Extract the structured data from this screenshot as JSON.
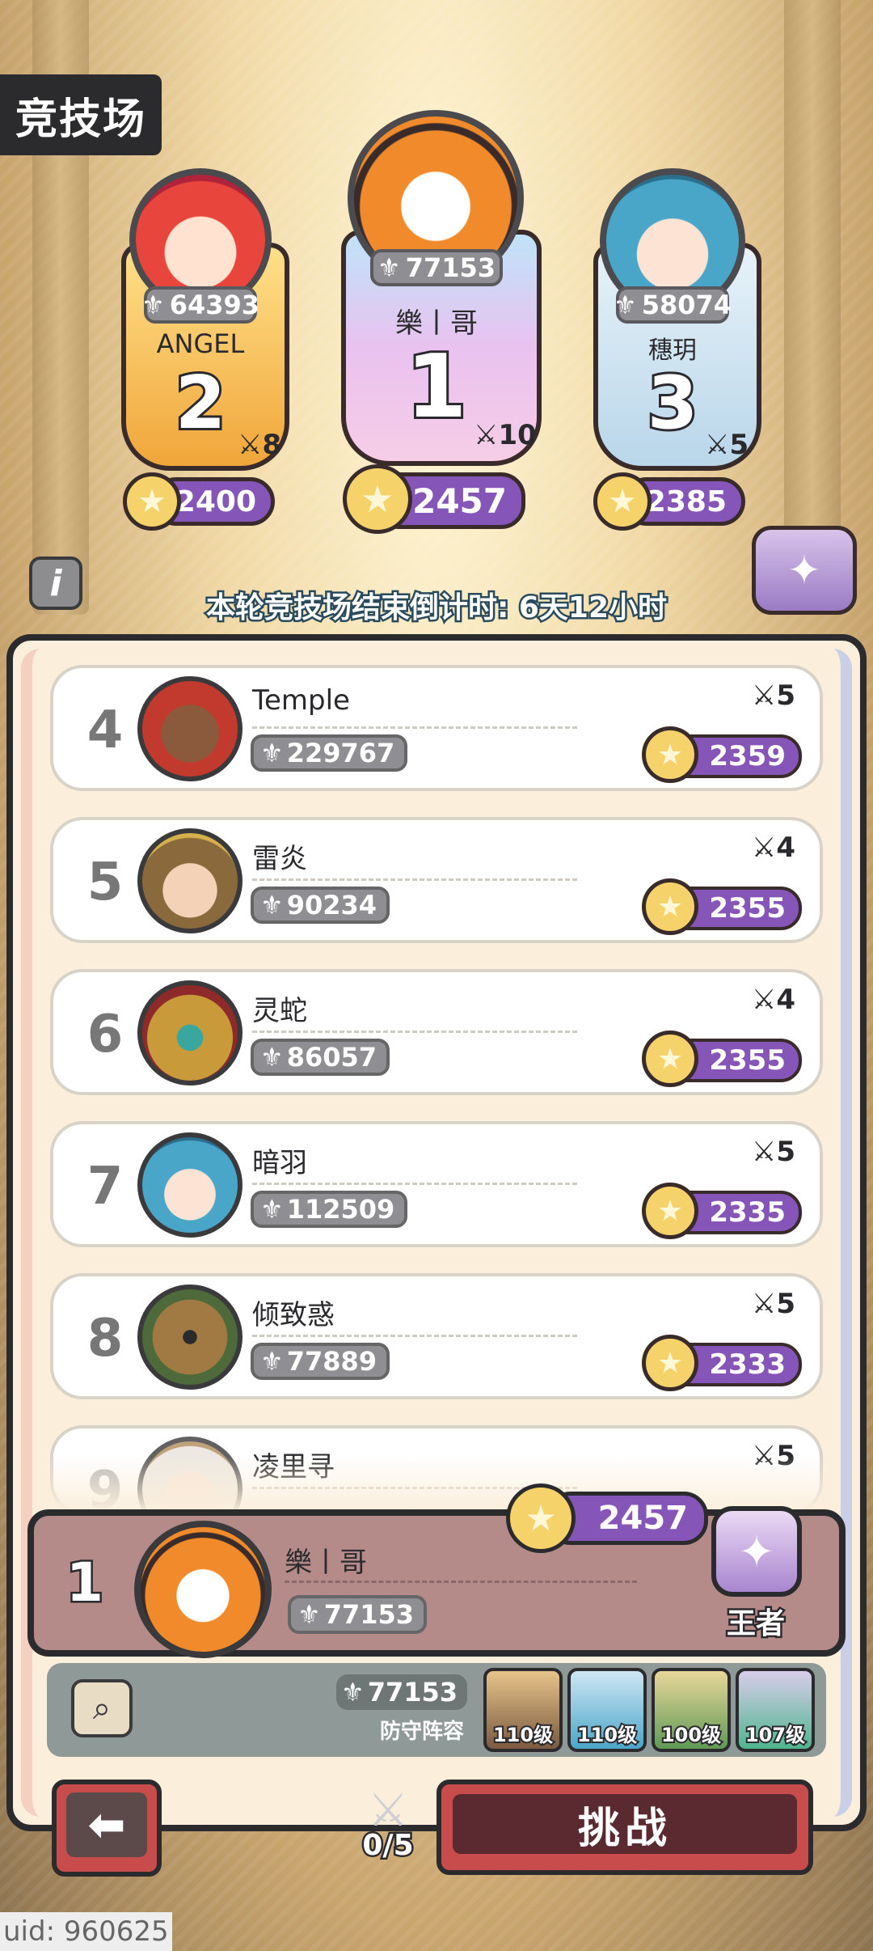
{
  "screen": {
    "title": "竞技场"
  },
  "top3": [
    {
      "rank": "2",
      "name": "ANGEL",
      "power": "64393",
      "score": "2400",
      "wins": "8",
      "color": "#f5b83a"
    },
    {
      "rank": "1",
      "name": "樂丨哥",
      "power": "77153",
      "score": "2457",
      "wins": "10",
      "color": "#c7b2ea"
    },
    {
      "rank": "3",
      "name": "穗玥",
      "power": "58074",
      "score": "2385",
      "wins": "5",
      "color": "#cfe6f4"
    }
  ],
  "countdown": "本轮竞技场结束倒计时: 6天12小时",
  "rows": [
    {
      "rank": "4",
      "name": "Temple",
      "power": "229767",
      "score": "2359",
      "wins": "5"
    },
    {
      "rank": "5",
      "name": "雷炎",
      "power": "90234",
      "score": "2355",
      "wins": "4"
    },
    {
      "rank": "6",
      "name": "灵蛇",
      "power": "86057",
      "score": "2355",
      "wins": "4"
    },
    {
      "rank": "7",
      "name": "暗羽",
      "power": "112509",
      "score": "2335",
      "wins": "5"
    },
    {
      "rank": "8",
      "name": "倾致惑",
      "power": "77889",
      "score": "2333",
      "wins": "5"
    },
    {
      "rank": "9",
      "name": "凌里寻",
      "wins": "5"
    }
  ],
  "me": {
    "rank": "1",
    "name": "樂丨哥",
    "power": "77153",
    "score": "2457",
    "tier": "王者"
  },
  "defense": {
    "power": "77153",
    "label": "防守阵容",
    "heroes": [
      {
        "level": "110级",
        "color": "#7b5a40"
      },
      {
        "level": "110级",
        "color": "#4aa6c8"
      },
      {
        "level": "100级",
        "color": "#5f9a55"
      },
      {
        "level": "107级",
        "color": "#4fb58f"
      }
    ]
  },
  "attempts": "0/5",
  "challenge_label": "挑战",
  "uid": "uid: 960625"
}
